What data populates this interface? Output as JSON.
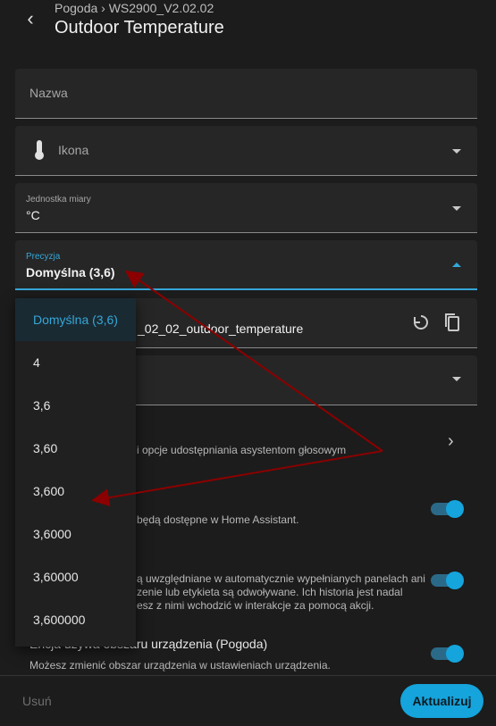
{
  "header": {
    "breadcrumb": "Pogoda › WS2900_V2.02.02",
    "title": "Outdoor Temperature"
  },
  "fields": {
    "name": {
      "placeholder": "Nazwa"
    },
    "icon": {
      "placeholder": "Ikona",
      "icon": "thermometer-icon"
    },
    "unit": {
      "label": "Jednostka miary",
      "value": "°C"
    },
    "precision": {
      "label": "Precyzja",
      "value": "Domyślna (3,6)"
    },
    "entity_id": {
      "value": "_02_02_outdoor_temperature"
    }
  },
  "sections": {
    "voice_desc": "i opcje udostępniania asystentom głosowym",
    "visible_desc": "będą dostępne w Home Assistant.",
    "dashboard_desc_1": "ą uwzględniane w automatycznie wypełnianych panelach ani",
    "dashboard_desc_2": "zenie lub etykieta są odwoływane. Ich historia jest nadal",
    "dashboard_desc_3": "esz z nimi wchodzić w interakcje za pomocą akcji.",
    "area_title": "Encja używa obszaru urządzenia (Pogoda)",
    "area_desc": "Możesz zmienić obszar urządzenia w ustawieniach urządzenia."
  },
  "menu": {
    "options": [
      "Domyślna (3,6)",
      "4",
      "3,6",
      "3,60",
      "3,600",
      "3,6000",
      "3,60000",
      "3,600000"
    ],
    "selected": "Domyślna (3,6)"
  },
  "footer": {
    "delete_label": "Usuń",
    "update_label": "Aktualizuj"
  },
  "colors": {
    "accent": "#15a4dc",
    "annotation": "#8b0000"
  }
}
